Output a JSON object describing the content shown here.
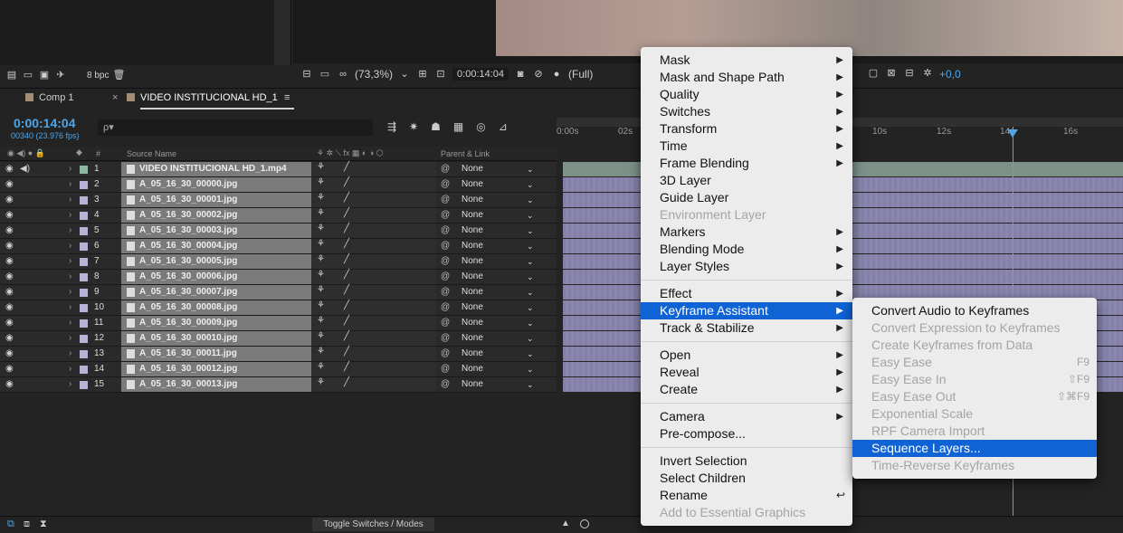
{
  "project_panel": {
    "bpc": "8 bpc"
  },
  "viewer": {
    "zoom": "(73,3%)",
    "timecode": "0:00:14:04",
    "resolution": "(Full)",
    "exposure": "+0,0"
  },
  "tabs": [
    {
      "label": "Comp 1"
    },
    {
      "label": "VIDEO INSTITUCIONAL HD_1"
    }
  ],
  "timeline": {
    "timecode": "0:00:14:04",
    "frames": "00340 (23.976 fps)",
    "search_placeholder": "ρ▾",
    "columns": {
      "num": "#",
      "source": "Source Name",
      "parent": "Parent & Link"
    },
    "ruler_labels": [
      "0:00s",
      "02s",
      "10s",
      "12s",
      "14s",
      "16s"
    ],
    "layers": [
      {
        "num": "1",
        "name": "VIDEO INSTITUCIONAL HD_1.mp4",
        "parent": "None"
      },
      {
        "num": "2",
        "name": "A_05_16_30_00000.jpg",
        "parent": "None"
      },
      {
        "num": "3",
        "name": "A_05_16_30_00001.jpg",
        "parent": "None"
      },
      {
        "num": "4",
        "name": "A_05_16_30_00002.jpg",
        "parent": "None"
      },
      {
        "num": "5",
        "name": "A_05_16_30_00003.jpg",
        "parent": "None"
      },
      {
        "num": "6",
        "name": "A_05_16_30_00004.jpg",
        "parent": "None"
      },
      {
        "num": "7",
        "name": "A_05_16_30_00005.jpg",
        "parent": "None"
      },
      {
        "num": "8",
        "name": "A_05_16_30_00006.jpg",
        "parent": "None"
      },
      {
        "num": "9",
        "name": "A_05_16_30_00007.jpg",
        "parent": "None"
      },
      {
        "num": "10",
        "name": "A_05_16_30_00008.jpg",
        "parent": "None"
      },
      {
        "num": "11",
        "name": "A_05_16_30_00009.jpg",
        "parent": "None"
      },
      {
        "num": "12",
        "name": "A_05_16_30_00010.jpg",
        "parent": "None"
      },
      {
        "num": "13",
        "name": "A_05_16_30_00011.jpg",
        "parent": "None"
      },
      {
        "num": "14",
        "name": "A_05_16_30_00012.jpg",
        "parent": "None"
      },
      {
        "num": "15",
        "name": "A_05_16_30_00013.jpg",
        "parent": "None"
      }
    ],
    "toggle_label": "Toggle Switches / Modes"
  },
  "context_menu": {
    "groups": [
      [
        {
          "label": "Mask",
          "arrow": true
        },
        {
          "label": "Mask and Shape Path",
          "arrow": true
        },
        {
          "label": "Quality",
          "arrow": true
        },
        {
          "label": "Switches",
          "arrow": true
        },
        {
          "label": "Transform",
          "arrow": true
        },
        {
          "label": "Time",
          "arrow": true
        },
        {
          "label": "Frame Blending",
          "arrow": true
        },
        {
          "label": "3D Layer"
        },
        {
          "label": "Guide Layer"
        },
        {
          "label": "Environment Layer",
          "disabled": true
        },
        {
          "label": "Markers",
          "arrow": true
        },
        {
          "label": "Blending Mode",
          "arrow": true
        },
        {
          "label": "Layer Styles",
          "arrow": true
        }
      ],
      [
        {
          "label": "Effect",
          "arrow": true
        },
        {
          "label": "Keyframe Assistant",
          "arrow": true,
          "selected": true
        },
        {
          "label": "Track & Stabilize",
          "arrow": true
        }
      ],
      [
        {
          "label": "Open",
          "arrow": true
        },
        {
          "label": "Reveal",
          "arrow": true
        },
        {
          "label": "Create",
          "arrow": true
        }
      ],
      [
        {
          "label": "Camera",
          "arrow": true
        },
        {
          "label": "Pre-compose..."
        }
      ],
      [
        {
          "label": "Invert Selection"
        },
        {
          "label": "Select Children"
        },
        {
          "label": "Rename",
          "shortcut": "↩"
        },
        {
          "label": "Add to Essential Graphics",
          "disabled": true
        }
      ]
    ]
  },
  "submenu": {
    "items": [
      {
        "label": "Convert Audio to Keyframes"
      },
      {
        "label": "Convert Expression to Keyframes",
        "disabled": true
      },
      {
        "label": "Create Keyframes from Data",
        "disabled": true
      },
      {
        "label": "Easy Ease",
        "disabled": true,
        "shortcut": "F9"
      },
      {
        "label": "Easy Ease In",
        "disabled": true,
        "shortcut": "⇧F9"
      },
      {
        "label": "Easy Ease Out",
        "disabled": true,
        "shortcut": "⇧⌘F9"
      },
      {
        "label": "Exponential Scale",
        "disabled": true
      },
      {
        "label": "RPF Camera Import",
        "disabled": true
      },
      {
        "label": "Sequence Layers...",
        "selected": true
      },
      {
        "label": "Time-Reverse Keyframes",
        "disabled": true
      }
    ]
  }
}
